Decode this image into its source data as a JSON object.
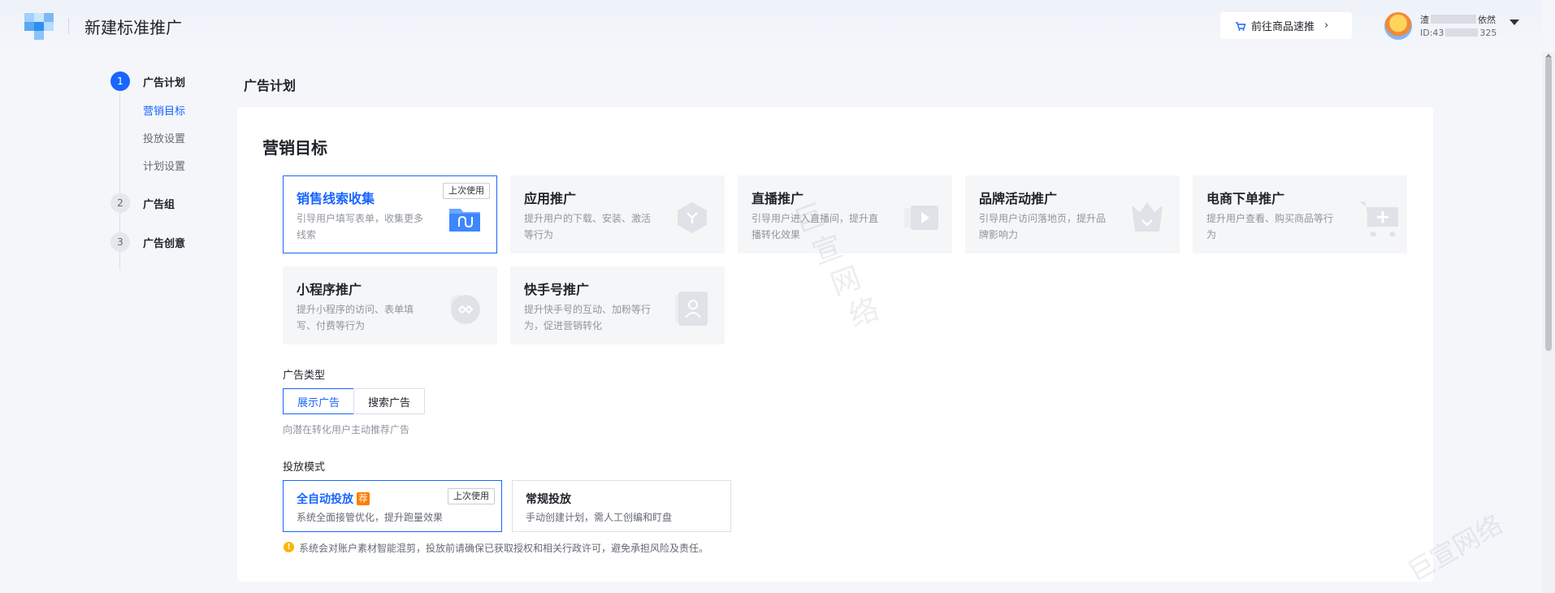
{
  "header": {
    "page_title": "新建标准推广",
    "goods_button": "前往商品速推",
    "account": {
      "name_start": "渣",
      "name_end": "依然",
      "id_prefix": "ID:43",
      "id_suffix": "325"
    }
  },
  "steps": [
    {
      "num": "1",
      "label": "广告计划",
      "state": "active"
    },
    {
      "num": "2",
      "label": "广告组",
      "state": "idle"
    },
    {
      "num": "3",
      "label": "广告创意",
      "state": "idle"
    }
  ],
  "sub_steps": [
    "营销目标",
    "投放设置",
    "计划设置"
  ],
  "main": {
    "section_title": "广告计划",
    "card_title": "营销目标",
    "goals": [
      {
        "title": "销售线索收集",
        "desc": "引导用户填写表单，收集更多线索",
        "badge": "上次使用",
        "icon": "folder-icon",
        "selected": true
      },
      {
        "title": "应用推广",
        "desc": "提升用户的下载、安装、激活等行为",
        "icon": "hexagon-app-icon"
      },
      {
        "title": "直播推广",
        "desc": "引导用户进入直播间，提升直播转化效果",
        "icon": "play-icon"
      },
      {
        "title": "品牌活动推广",
        "desc": "引导用户访问落地页，提升品牌影响力",
        "icon": "crown-icon"
      },
      {
        "title": "电商下单推广",
        "desc": "提升用户查看、购买商品等行为",
        "icon": "cart-icon"
      },
      {
        "title": "小程序推广",
        "desc": "提升小程序的访问、表单填写、付费等行为",
        "icon": "mini-program-icon"
      },
      {
        "title": "快手号推广",
        "desc": "提升快手号的互动、加粉等行为，促进营销转化",
        "icon": "profile-icon"
      }
    ],
    "ad_type": {
      "label": "广告类型",
      "options": [
        "展示广告",
        "搜索广告"
      ],
      "selected": "展示广告",
      "hint": "向潜在转化用户主动推荐广告"
    },
    "delivery_mode": {
      "label": "投放模式",
      "options": [
        {
          "title": "全自动投放",
          "tag": "荐",
          "badge": "上次使用",
          "desc": "系统全面接管优化，提升跑量效果",
          "selected": true
        },
        {
          "title": "常规投放",
          "desc": "手动创建计划，需人工创编和盯盘"
        }
      ]
    },
    "warning": "系统会对账户素材智能混剪，投放前请确保已获取授权和相关行政许可，避免承担风险及责任。"
  },
  "watermark": {
    "vertical": [
      "巨",
      "宣",
      "网",
      "络"
    ],
    "corner": "巨宣网络"
  }
}
